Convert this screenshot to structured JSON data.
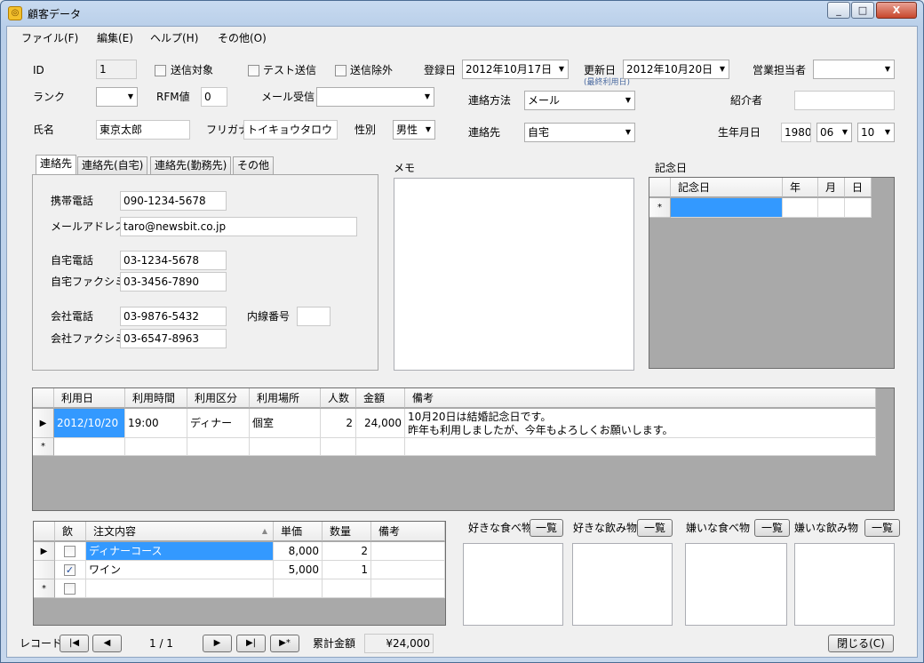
{
  "window": {
    "title": "顧客データ",
    "minimize": "_",
    "maximize": "□",
    "close": "X"
  },
  "menu": [
    "ファイル(F)",
    "編集(E)",
    "ヘルプ(H)",
    "その他(O)"
  ],
  "header": {
    "id_label": "ID",
    "id_value": "1",
    "send_target": "送信対象",
    "test_send": "テスト送信",
    "send_exclude": "送信除外",
    "register_date_label": "登録日",
    "register_date": "2012年10月17日",
    "update_date_label": "更新日",
    "update_date": "2012年10月20日",
    "update_note": "(最終利用日)",
    "sales_label": "営業担当者",
    "sales_value": "",
    "rank_label": "ランク",
    "rank_value": "",
    "rfm_label": "RFM値",
    "rfm_value": "0",
    "mail_recv_label": "メール受信",
    "mail_recv_value": "",
    "contact_method_label": "連絡方法",
    "contact_method_value": "メール",
    "introducer_label": "紹介者",
    "introducer_value": "",
    "name_label": "氏名",
    "name_value": "東京太郎",
    "furigana_label": "フリガナ",
    "furigana_value": "トイキョウタロウ",
    "gender_label": "性別",
    "gender_value": "男性",
    "contact_label": "連絡先",
    "contact_value": "自宅",
    "birth_label": "生年月日",
    "birth_year": "1980",
    "birth_month": "06",
    "birth_day": "10"
  },
  "tabs": [
    "連絡先",
    "連絡先(自宅)",
    "連絡先(勤務先)",
    "その他"
  ],
  "contact": {
    "mobile_label": "携帯電話",
    "mobile": "090-1234-5678",
    "email_label": "メールアドレス",
    "email": "taro@newsbit.co.jp",
    "home_tel_label": "自宅電話",
    "home_tel": "03-1234-5678",
    "home_fax_label": "自宅ファクシミリ",
    "home_fax": "03-3456-7890",
    "office_tel_label": "会社電話",
    "office_tel": "03-9876-5432",
    "ext_label": "内線番号",
    "ext": "",
    "office_fax_label": "会社ファクシミリ",
    "office_fax": "03-6547-8963"
  },
  "memo_label": "メモ",
  "anniversary": {
    "label": "記念日",
    "headers": [
      "記念日",
      "年",
      "月",
      "日"
    ],
    "new_row_marker": "*"
  },
  "usage": {
    "headers": [
      "利用日",
      "利用時間",
      "利用区分",
      "利用場所",
      "人数",
      "金額",
      "備考"
    ],
    "rows": [
      {
        "date": "2012/10/20",
        "time": "19:00",
        "type": "ディナー",
        "place": "個室",
        "people": "2",
        "amount": "24,000",
        "note1": "10月20日は結婚記念日です。",
        "note2": "昨年も利用しましたが、今年もよろしくお願いします。"
      }
    ],
    "current_marker": "▶",
    "new_row_marker": "*"
  },
  "orders": {
    "headers": [
      "飲",
      "注文内容",
      "単価",
      "数量",
      "備考"
    ],
    "rows": [
      {
        "drink": false,
        "item": "ディナーコース",
        "price": "8,000",
        "qty": "2",
        "note": ""
      },
      {
        "drink": true,
        "item": "ワイン",
        "price": "5,000",
        "qty": "1",
        "note": ""
      }
    ],
    "current_marker": "▶",
    "new_row_marker": "*"
  },
  "prefs": [
    {
      "label": "好きな食べ物",
      "button": "一覧"
    },
    {
      "label": "好きな飲み物",
      "button": "一覧"
    },
    {
      "label": "嫌いな食べ物",
      "button": "一覧"
    },
    {
      "label": "嫌いな飲み物",
      "button": "一覧"
    }
  ],
  "footer": {
    "record_label": "レコード:",
    "record_position": "1 / 1",
    "first": "|◀",
    "prev": "◀",
    "next": "▶",
    "last": "▶|",
    "new": "▶*",
    "total_label": "累計金額",
    "total_value": "¥24,000",
    "close_button": "閉じる(C)"
  }
}
